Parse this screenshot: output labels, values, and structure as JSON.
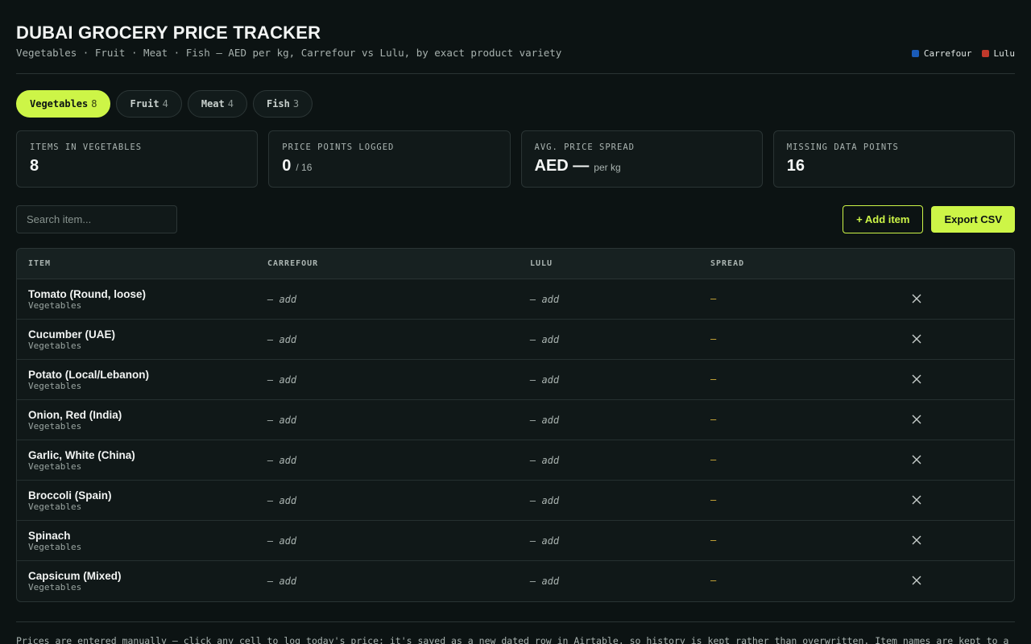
{
  "header": {
    "title": "DUBAI GROCERY PRICE TRACKER",
    "subtitle": "Vegetables · Fruit · Meat · Fish — AED per kg, Carrefour vs Lulu, by exact product variety"
  },
  "legend": [
    {
      "label": "Carrefour",
      "color": "#1a5bb8"
    },
    {
      "label": "Lulu",
      "color": "#c0392b"
    }
  ],
  "tabs": [
    {
      "label": "Vegetables",
      "count": "8",
      "active": true
    },
    {
      "label": "Fruit",
      "count": "4",
      "active": false
    },
    {
      "label": "Meat",
      "count": "4",
      "active": false
    },
    {
      "label": "Fish",
      "count": "3",
      "active": false
    }
  ],
  "stats": [
    {
      "label": "ITEMS IN VEGETABLES",
      "value": "8",
      "suffix": ""
    },
    {
      "label": "PRICE POINTS LOGGED",
      "value": "0",
      "suffix": "/ 16"
    },
    {
      "label": "AVG. PRICE SPREAD",
      "value": "AED —",
      "suffix": "per kg"
    },
    {
      "label": "MISSING DATA POINTS",
      "value": "16",
      "suffix": ""
    }
  ],
  "search": {
    "placeholder": "Search item..."
  },
  "actions": {
    "add_label": "+ Add item",
    "export_label": "Export CSV"
  },
  "table": {
    "headers": {
      "item": "ITEM",
      "carrefour": "CARREFOUR",
      "lulu": "LULU",
      "spread": "SPREAD"
    },
    "rows": [
      {
        "name": "Tomato (Round, loose)",
        "category": "Vegetables",
        "carrefour": "— add",
        "lulu": "— add",
        "spread": "—"
      },
      {
        "name": "Cucumber (UAE)",
        "category": "Vegetables",
        "carrefour": "— add",
        "lulu": "— add",
        "spread": "—"
      },
      {
        "name": "Potato (Local/Lebanon)",
        "category": "Vegetables",
        "carrefour": "— add",
        "lulu": "— add",
        "spread": "—"
      },
      {
        "name": "Onion, Red (India)",
        "category": "Vegetables",
        "carrefour": "— add",
        "lulu": "— add",
        "spread": "—"
      },
      {
        "name": "Garlic, White (China)",
        "category": "Vegetables",
        "carrefour": "— add",
        "lulu": "— add",
        "spread": "—"
      },
      {
        "name": "Broccoli (Spain)",
        "category": "Vegetables",
        "carrefour": "— add",
        "lulu": "— add",
        "spread": "—"
      },
      {
        "name": "Spinach",
        "category": "Vegetables",
        "carrefour": "— add",
        "lulu": "— add",
        "spread": "—"
      },
      {
        "name": "Capsicum (Mixed)",
        "category": "Vegetables",
        "carrefour": "— add",
        "lulu": "— add",
        "spread": "—"
      }
    ]
  },
  "footnote": "Prices are entered manually — click any cell to log today's price; it's saved as a new dated row in Airtable, so history is kept rather than overwritten. Item names are kept to a"
}
